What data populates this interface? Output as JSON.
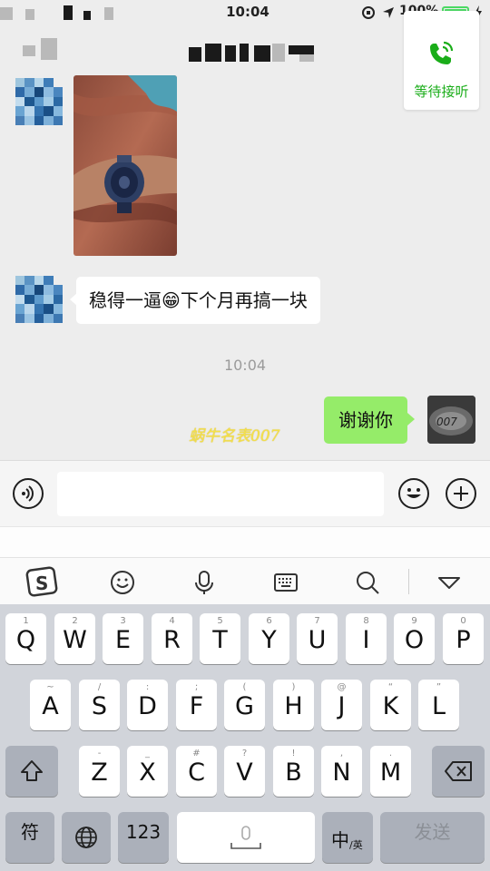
{
  "status_bar": {
    "time": "10:04",
    "battery_percent": "100%",
    "battery_color": "#4cd964"
  },
  "call_card": {
    "label": "等待接听",
    "icon": "phone-icon",
    "accent": "#1aad19"
  },
  "chat": {
    "messages": [
      {
        "direction": "in",
        "type": "image",
        "content": "watch-photo"
      },
      {
        "direction": "in",
        "type": "text",
        "text_before": "稳得一逼",
        "emoji": "😁",
        "text_after": "下个月再搞一块"
      },
      {
        "type": "timestamp",
        "text": "10:04"
      },
      {
        "direction": "out",
        "type": "text",
        "text": "谢谢你"
      }
    ],
    "watermark": "蜗牛名表007",
    "self_avatar_text": "007"
  },
  "input_bar": {
    "voice_icon": "voice-icon",
    "emoji_icon": "emoji-icon",
    "plus_icon": "plus-icon",
    "value": ""
  },
  "ime_toolbar": {
    "items": [
      "sogou-logo-icon",
      "smiley-icon",
      "microphone-icon",
      "keyboard-icon",
      "search-icon",
      "collapse-icon"
    ]
  },
  "keyboard": {
    "row1": [
      {
        "main": "Q",
        "sub": "1"
      },
      {
        "main": "W",
        "sub": "2"
      },
      {
        "main": "E",
        "sub": "3"
      },
      {
        "main": "R",
        "sub": "4"
      },
      {
        "main": "T",
        "sub": "5"
      },
      {
        "main": "Y",
        "sub": "6"
      },
      {
        "main": "U",
        "sub": "7"
      },
      {
        "main": "I",
        "sub": "8"
      },
      {
        "main": "O",
        "sub": "9"
      },
      {
        "main": "P",
        "sub": "0"
      }
    ],
    "row2": [
      {
        "main": "A",
        "sub": "~"
      },
      {
        "main": "S",
        "sub": "/"
      },
      {
        "main": "D",
        "sub": ":"
      },
      {
        "main": "F",
        "sub": ";"
      },
      {
        "main": "G",
        "sub": "("
      },
      {
        "main": "H",
        "sub": ")"
      },
      {
        "main": "J",
        "sub": "@"
      },
      {
        "main": "K",
        "sub": "“"
      },
      {
        "main": "L",
        "sub": "”"
      }
    ],
    "row3": [
      {
        "main": "Z",
        "sub": "-"
      },
      {
        "main": "X",
        "sub": "_"
      },
      {
        "main": "C",
        "sub": "#"
      },
      {
        "main": "V",
        "sub": "?"
      },
      {
        "main": "B",
        "sub": "!"
      },
      {
        "main": "N",
        "sub": ","
      },
      {
        "main": "M",
        "sub": "."
      }
    ],
    "symbols_label": "符",
    "numbers_label": "123",
    "language_label": "中",
    "language_sub": "/英",
    "send_label": "发送"
  }
}
